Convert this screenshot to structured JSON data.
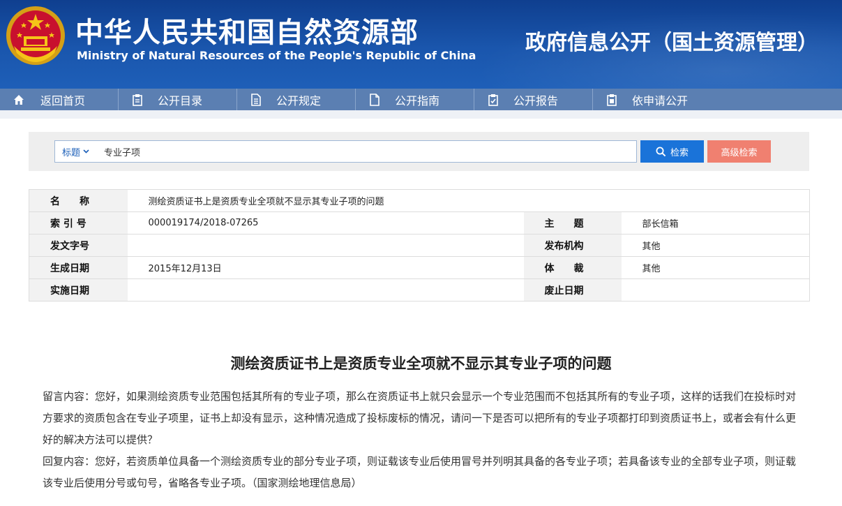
{
  "header": {
    "cn_title": "中华人民共和国自然资源部",
    "en_title": "Ministry of Natural Resources of the People's Republic of China",
    "right_title": "政府信息公开（国土资源管理）",
    "emblem_icon": "national-emblem-icon"
  },
  "nav": {
    "items": [
      {
        "label": "返回首页",
        "icon": "home-icon"
      },
      {
        "label": "公开目录",
        "icon": "clipboard-icon"
      },
      {
        "label": "公开规定",
        "icon": "document-icon"
      },
      {
        "label": "公开指南",
        "icon": "file-edit-icon"
      },
      {
        "label": "公开报告",
        "icon": "checklist-icon"
      },
      {
        "label": "依申请公开",
        "icon": "clipboard-list-icon"
      }
    ]
  },
  "search": {
    "type_label": "标题",
    "value": "专业子项",
    "search_button": "检索",
    "advanced_button": "高级检索"
  },
  "meta": {
    "name_label": "名　　称",
    "name_value": "测绘资质证书上是资质专业全项就不显示其专业子项的问题",
    "index_label": "索 引 号",
    "index_value": "000019174/2018-07265",
    "topic_label": "主　　题",
    "topic_value": "部长信箱",
    "docno_label": "发文字号",
    "docno_value": "",
    "publisher_label": "发布机构",
    "publisher_value": "其他",
    "date_label": "生成日期",
    "date_value": "2015年12月13日",
    "genre_label": "体　　裁",
    "genre_value": "其他",
    "effective_label": "实施日期",
    "effective_value": "",
    "expire_label": "废止日期",
    "expire_value": ""
  },
  "article": {
    "title": "测绘资质证书上是资质专业全项就不显示其专业子项的问题",
    "question": "留言内容：您好，如果测绘资质专业范围包括其所有的专业子项，那么在资质证书上就只会显示一个专业范围而不包括其所有的专业子项，这样的话我们在投标时对方要求的资质包含在专业子项里，证书上却没有显示，这种情况造成了投标废标的情况，请问一下是否可以把所有的专业子项都打印到资质证书上，或者会有什么更好的解决方法可以提供？",
    "answer": "回复内容：您好，若资质单位具备一个测绘资质专业的部分专业子项，则证载该专业后使用冒号并列明其具备的各专业子项；若具备该专业的全部专业子项，则证载该专业后使用分号或句号，省略各专业子项。（国家测绘地理信息局）"
  },
  "colors": {
    "header_blue": "#1a56ad",
    "nav_blue": "#5b7fb2",
    "search_blue": "#1a73d9",
    "advanced_salmon": "#f08070"
  }
}
